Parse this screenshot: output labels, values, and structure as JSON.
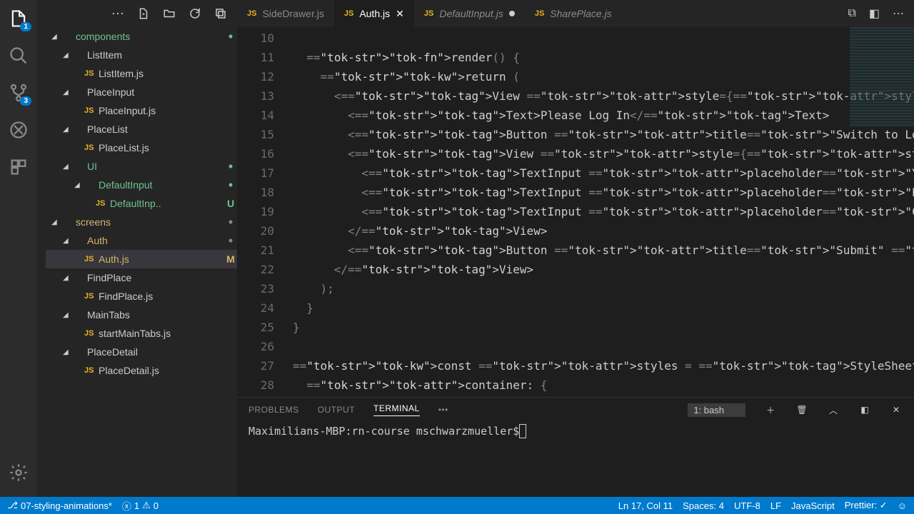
{
  "activityBar": {
    "explorerBadge": "1",
    "scmBadge": "3"
  },
  "sidebar": {
    "items": [
      {
        "type": "folder",
        "label": "components",
        "indent": 0,
        "expanded": true,
        "status": "dot-green",
        "color": "green"
      },
      {
        "type": "folder",
        "label": "ListItem",
        "indent": 1,
        "expanded": true
      },
      {
        "type": "file",
        "label": "ListItem.js",
        "indent": 2
      },
      {
        "type": "folder",
        "label": "PlaceInput",
        "indent": 1,
        "expanded": true
      },
      {
        "type": "file",
        "label": "PlaceInput.js",
        "indent": 2
      },
      {
        "type": "folder",
        "label": "PlaceList",
        "indent": 1,
        "expanded": true
      },
      {
        "type": "file",
        "label": "PlaceList.js",
        "indent": 2
      },
      {
        "type": "folder",
        "label": "UI",
        "indent": 1,
        "expanded": true,
        "status": "dot-green",
        "color": "green"
      },
      {
        "type": "folder",
        "label": "DefaultInput",
        "indent": 2,
        "expanded": true,
        "status": "dot-green",
        "color": "green"
      },
      {
        "type": "file",
        "label": "DefaultInp..",
        "indent": 3,
        "status": "u",
        "color": "green"
      },
      {
        "type": "folder",
        "label": "screens",
        "indent": 0,
        "expanded": true,
        "status": "dot-gray",
        "color": "yellow"
      },
      {
        "type": "folder",
        "label": "Auth",
        "indent": 1,
        "expanded": true,
        "status": "dot-gray",
        "color": "yellow"
      },
      {
        "type": "file",
        "label": "Auth.js",
        "indent": 2,
        "selected": true,
        "status": "m",
        "color": "yellow"
      },
      {
        "type": "folder",
        "label": "FindPlace",
        "indent": 1,
        "expanded": true
      },
      {
        "type": "file",
        "label": "FindPlace.js",
        "indent": 2
      },
      {
        "type": "folder",
        "label": "MainTabs",
        "indent": 1,
        "expanded": true
      },
      {
        "type": "file",
        "label": "startMainTabs.js",
        "indent": 2
      },
      {
        "type": "folder",
        "label": "PlaceDetail",
        "indent": 1,
        "expanded": true
      },
      {
        "type": "file",
        "label": "PlaceDetail.js",
        "indent": 2
      }
    ]
  },
  "tabs": [
    {
      "label": "SideDrawer.js",
      "active": false,
      "close": false
    },
    {
      "label": "Auth.js",
      "active": true,
      "close": true
    },
    {
      "label": "DefaultInput.js",
      "active": false,
      "dirty": true,
      "italic": true
    },
    {
      "label": "SharePlace.js",
      "active": false,
      "italic": true
    }
  ],
  "editor": {
    "startLine": 10,
    "lines": [
      "",
      "  render() {",
      "    return (",
      "      <View style={styles.container}>",
      "        <Text>Please Log In</Text>",
      "        <Button title=\"Switch to Login\" />",
      "        <View style={styles.inputContainer}>",
      "          <TextInput placeholder=\"Your E-Mail Address\" style={styles.in",
      "          <TextInput placeholder=\"Password\" style={styles.input} underl",
      "          <TextInput placeholder=\"Confirm Password\" style={styles.input",
      "        </View>",
      "        <Button title=\"Submit\" onPress={this.loginHandler} />",
      "      </View>",
      "    );",
      "  }",
      "}",
      "",
      "const styles = StyleSheet.create({",
      "  container: {"
    ]
  },
  "panel": {
    "tabs": [
      "PROBLEMS",
      "OUTPUT",
      "TERMINAL"
    ],
    "activeTab": 2,
    "terminalSelector": "1: bash",
    "terminalLine": "Maximilians-MBP:rn-course mschwarzmueller$ "
  },
  "statusBar": {
    "branch": "07-styling-animations*",
    "errors": "1",
    "warnings": "0",
    "cursor": "Ln 17, Col 11",
    "spaces": "Spaces: 4",
    "encoding": "UTF-8",
    "eol": "LF",
    "language": "JavaScript",
    "prettier": "Prettier: ✓"
  }
}
